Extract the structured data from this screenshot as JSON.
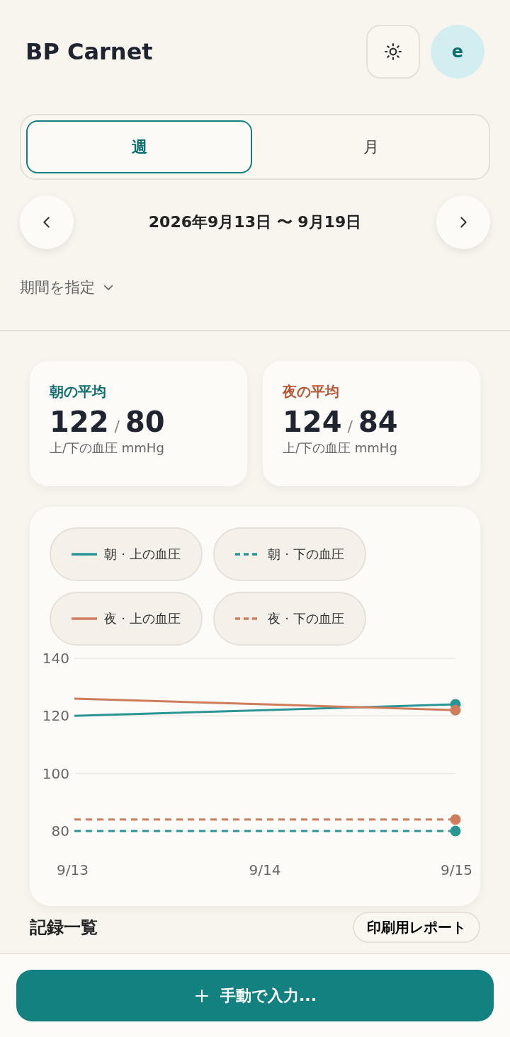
{
  "header": {
    "title": "BP Carnet",
    "avatar": "e"
  },
  "period_tabs": [
    {
      "label": "週",
      "selected": true
    },
    {
      "label": "月",
      "selected": false
    }
  ],
  "date_range": "2026年9月13日 〜 9月19日",
  "range_picker": "期間を指定",
  "averages": [
    {
      "label": "朝の平均",
      "color": "#0f6e6e",
      "systolic": "122",
      "separator": "/",
      "diastolic": "80",
      "unit": "上/下の血圧 mmHg"
    },
    {
      "label": "夜の平均",
      "color": "#b35a38",
      "systolic": "124",
      "separator": "/",
      "diastolic": "84",
      "unit": "上/下の血圧 mmHg"
    }
  ],
  "chart": {
    "chart_data": {
      "type": "line",
      "legend": "top",
      "categories": [
        "9/13",
        "9/14",
        "9/15"
      ],
      "ylim": [
        80,
        140
      ],
      "yticks": [
        80,
        100,
        120,
        140
      ],
      "series": [
        {
          "name": "朝 · 上の血圧",
          "color": "#2a9595",
          "line_style": "solid",
          "values": [
            120,
            122,
            124
          ]
        },
        {
          "name": "朝 · 下の血圧",
          "color": "#2a9595",
          "line_style": "dashed",
          "values": [
            80,
            80,
            80
          ]
        },
        {
          "name": "夜 · 上の血圧",
          "color": "#cf7c5c",
          "line_style": "solid",
          "values": [
            126,
            124,
            122
          ]
        },
        {
          "name": "夜 · 下の血圧",
          "color": "#cf7c5c",
          "line_style": "dashed",
          "values": [
            84,
            84,
            84
          ]
        }
      ]
    }
  },
  "records": {
    "title": "記録一覧",
    "print_button": "印刷用レポート"
  },
  "add_button": "手動で入力..."
}
